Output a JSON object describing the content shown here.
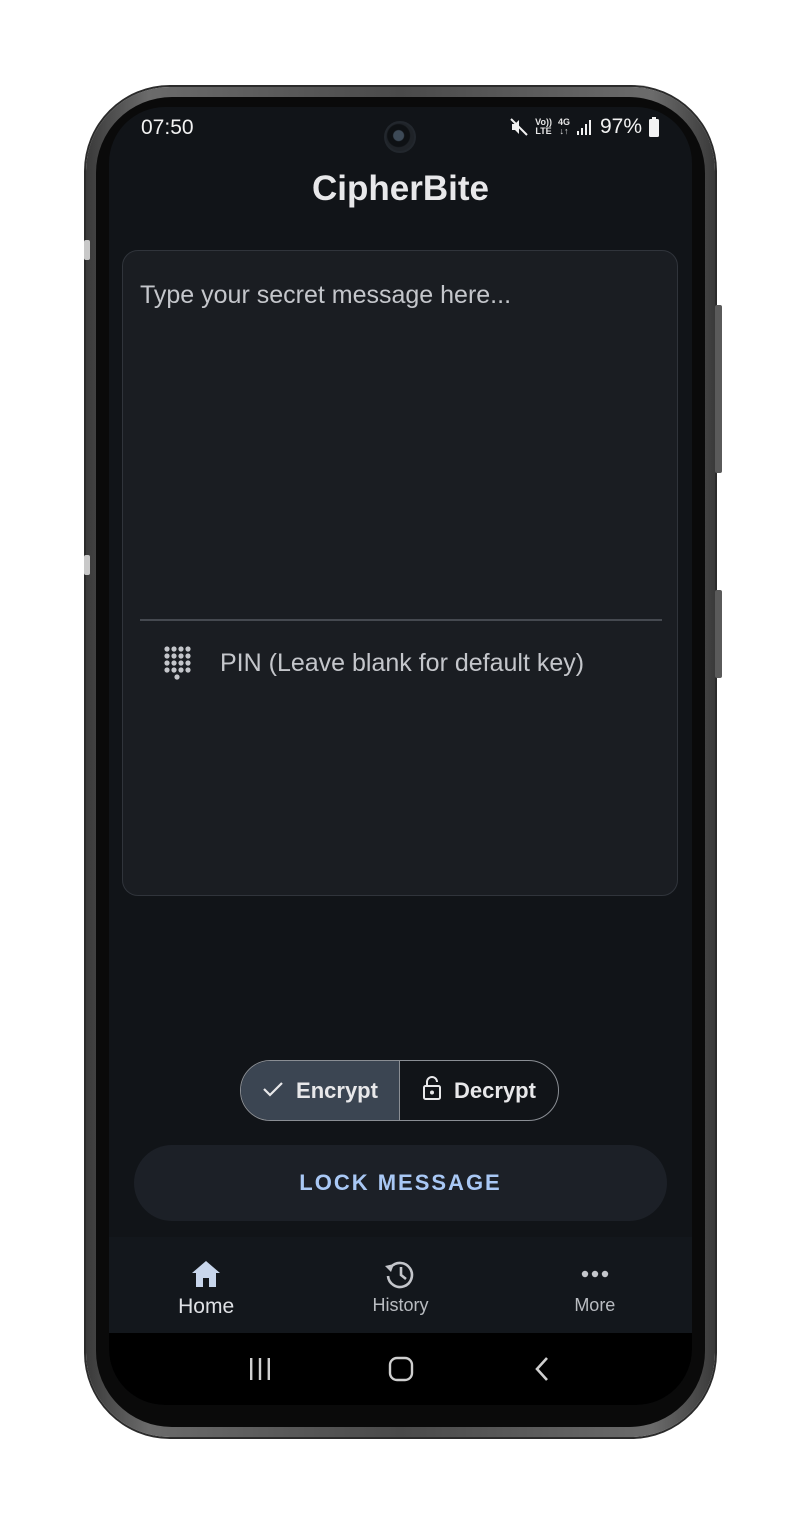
{
  "status_bar": {
    "time": "07:50",
    "network_volte": "Vo))",
    "network_lte": "LTE",
    "network_4g": "4G",
    "battery_percent": "97%",
    "battery_level": 0.97
  },
  "app": {
    "title": "CipherBite"
  },
  "message_field": {
    "placeholder": "Type your secret message here...",
    "value": ""
  },
  "pin_field": {
    "placeholder": "PIN (Leave blank for default key)",
    "value": ""
  },
  "mode_toggle": {
    "encrypt_label": "Encrypt",
    "decrypt_label": "Decrypt",
    "selected": "Encrypt"
  },
  "action": {
    "lock_label": "LOCK MESSAGE"
  },
  "bottom_nav": {
    "items": [
      {
        "label": "Home",
        "icon": "home-icon",
        "active": true
      },
      {
        "label": "History",
        "icon": "history-icon",
        "active": false
      },
      {
        "label": "More",
        "icon": "more-icon",
        "active": false
      }
    ]
  },
  "colors": {
    "background": "#111418",
    "card": "#1a1d22",
    "accent_text": "#a9c8f5",
    "selected_segment": "#3b4552"
  }
}
